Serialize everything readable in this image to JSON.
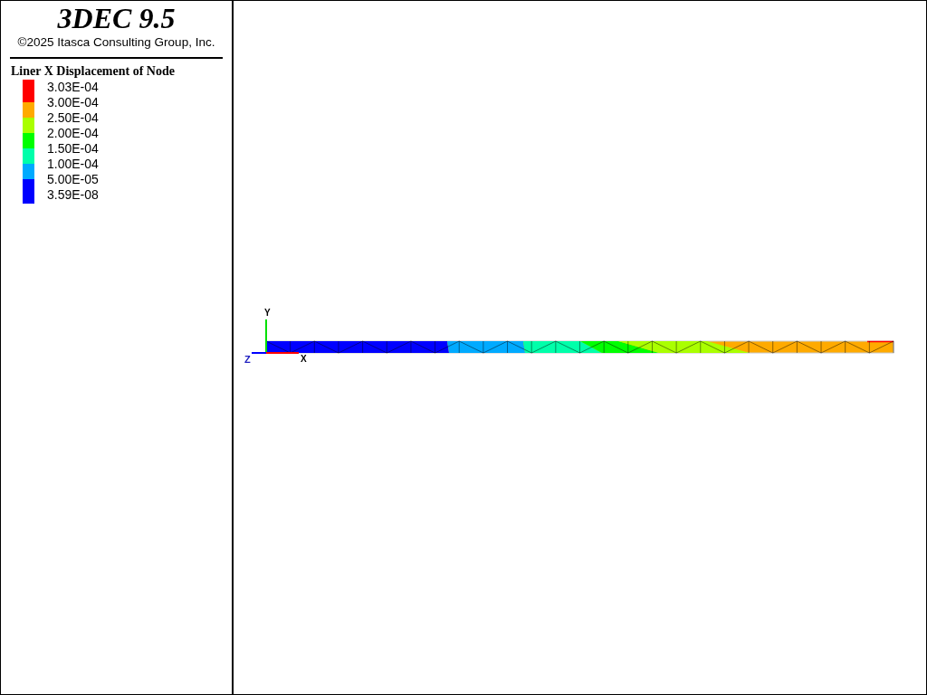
{
  "header": {
    "title": "3DEC 9.5",
    "copyright": "©2025 Itasca Consulting Group, Inc."
  },
  "legend": {
    "title": "Liner X Displacement of Node",
    "levels": [
      "3.03E-04",
      "3.00E-04",
      "2.50E-04",
      "2.00E-04",
      "1.50E-04",
      "1.00E-04",
      "5.00E-05",
      "3.59E-08"
    ],
    "bands": [
      {
        "color": "#ff0000"
      },
      {
        "color": "#ffaa00"
      },
      {
        "color": "#aaff00"
      },
      {
        "color": "#00ff00"
      },
      {
        "color": "#00ffaa"
      },
      {
        "color": "#00aaff"
      },
      {
        "color": "#0000ff"
      }
    ]
  },
  "axes": {
    "x": "X",
    "y": "Y",
    "z": "Z"
  }
}
